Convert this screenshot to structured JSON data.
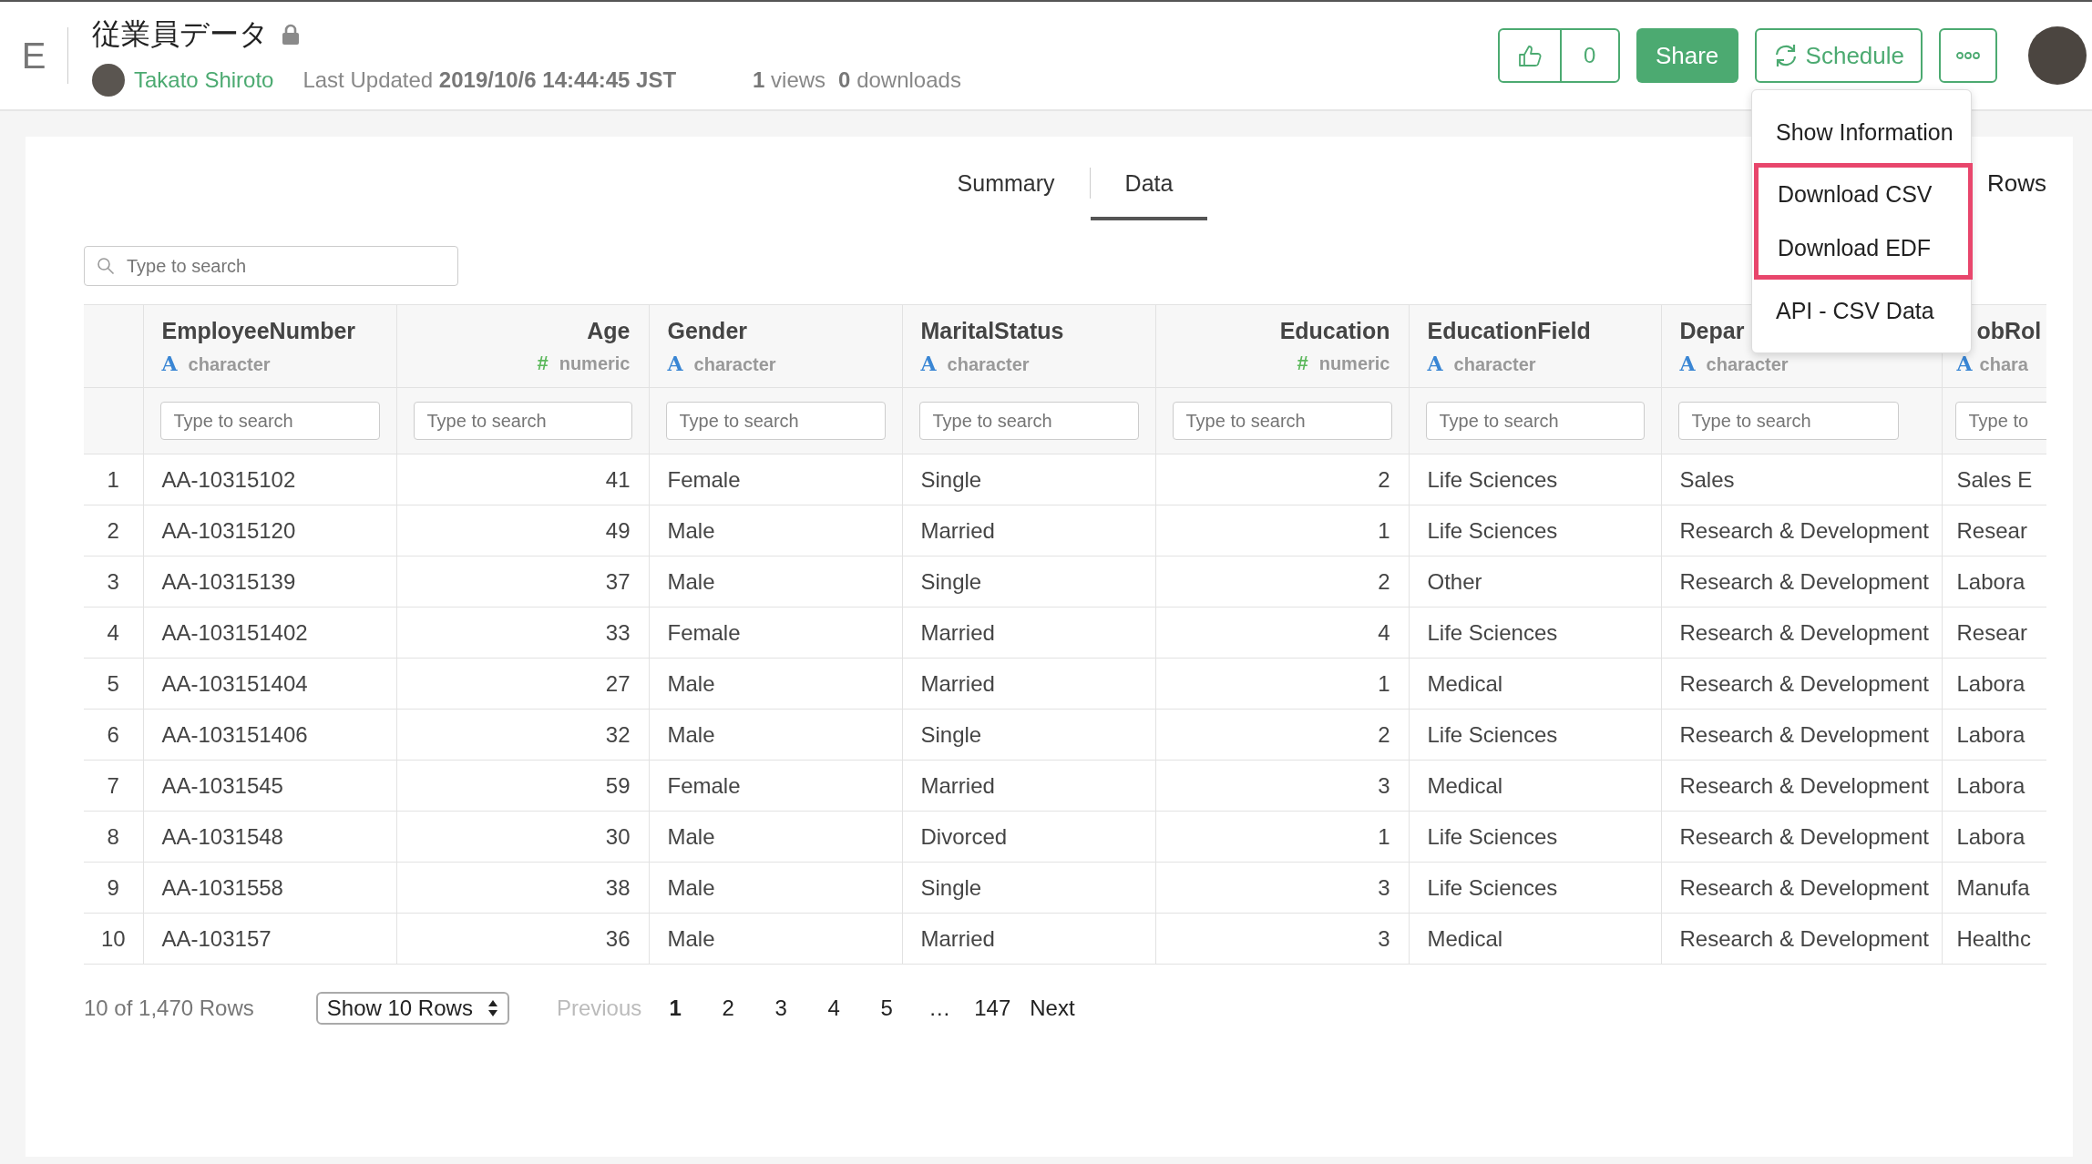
{
  "header": {
    "logo": "E",
    "title": "従業員データ",
    "locked": true,
    "author": "Takato Shiroto",
    "updated_label": "Last Updated",
    "updated_value": "2019/10/6 14:44:45 JST",
    "views_count": "1",
    "views_label": "views",
    "downloads_count": "0",
    "downloads_label": "downloads",
    "like_count": "0",
    "share_label": "Share",
    "schedule_label": "Schedule"
  },
  "menu": {
    "items": [
      {
        "label": "Show Information",
        "highlighted": false
      },
      {
        "label": "Download CSV",
        "highlighted": true
      },
      {
        "label": "Download EDF",
        "highlighted": true
      },
      {
        "label": "API - CSV Data",
        "highlighted": false
      }
    ]
  },
  "tabs": [
    {
      "label": "Summary",
      "selected": false
    },
    {
      "label": "Data",
      "selected": true
    }
  ],
  "rows_label": "Rows",
  "search": {
    "placeholder": "Type to search"
  },
  "table": {
    "columns": [
      {
        "name": "EmployeeNumber",
        "kind": "character",
        "type_icon": "A",
        "type_label": "character",
        "filter_placeholder": "Type to search"
      },
      {
        "name": "Age",
        "kind": "numeric",
        "type_icon": "#",
        "type_label": "numeric",
        "filter_placeholder": "Type to search"
      },
      {
        "name": "Gender",
        "kind": "character",
        "type_icon": "A",
        "type_label": "character",
        "filter_placeholder": "Type to search"
      },
      {
        "name": "MaritalStatus",
        "kind": "character",
        "type_icon": "A",
        "type_label": "character",
        "filter_placeholder": "Type to search"
      },
      {
        "name": "Education",
        "kind": "numeric",
        "type_icon": "#",
        "type_label": "numeric",
        "filter_placeholder": "Type to search"
      },
      {
        "name": "EducationField",
        "kind": "character",
        "type_icon": "A",
        "type_label": "character",
        "filter_placeholder": "Type to search"
      },
      {
        "name": "Depar",
        "kind": "character",
        "type_icon": "A",
        "type_label": "character",
        "filter_placeholder": "Type to search"
      },
      {
        "name": "obRol",
        "kind": "character",
        "type_icon": "A",
        "type_label": "chara",
        "filter_placeholder": "Type to"
      }
    ],
    "rows": [
      {
        "number": "1",
        "cells": [
          "AA-10315102",
          "41",
          "Female",
          "Single",
          "2",
          "Life Sciences",
          "Sales",
          "Sales E"
        ]
      },
      {
        "number": "2",
        "cells": [
          "AA-10315120",
          "49",
          "Male",
          "Married",
          "1",
          "Life Sciences",
          "Research & Development",
          "Resear"
        ]
      },
      {
        "number": "3",
        "cells": [
          "AA-10315139",
          "37",
          "Male",
          "Single",
          "2",
          "Other",
          "Research & Development",
          "Labora"
        ]
      },
      {
        "number": "4",
        "cells": [
          "AA-103151402",
          "33",
          "Female",
          "Married",
          "4",
          "Life Sciences",
          "Research & Development",
          "Resear"
        ]
      },
      {
        "number": "5",
        "cells": [
          "AA-103151404",
          "27",
          "Male",
          "Married",
          "1",
          "Medical",
          "Research & Development",
          "Labora"
        ]
      },
      {
        "number": "6",
        "cells": [
          "AA-103151406",
          "32",
          "Male",
          "Single",
          "2",
          "Life Sciences",
          "Research & Development",
          "Labora"
        ]
      },
      {
        "number": "7",
        "cells": [
          "AA-1031545",
          "59",
          "Female",
          "Married",
          "3",
          "Medical",
          "Research & Development",
          "Labora"
        ]
      },
      {
        "number": "8",
        "cells": [
          "AA-1031548",
          "30",
          "Male",
          "Divorced",
          "1",
          "Life Sciences",
          "Research & Development",
          "Labora"
        ]
      },
      {
        "number": "9",
        "cells": [
          "AA-1031558",
          "38",
          "Male",
          "Single",
          "3",
          "Life Sciences",
          "Research & Development",
          "Manufa"
        ]
      },
      {
        "number": "10",
        "cells": [
          "AA-103157",
          "36",
          "Male",
          "Married",
          "3",
          "Medical",
          "Research & Development",
          "Healthc"
        ]
      }
    ]
  },
  "pagination": {
    "summary": "10 of 1,470 Rows",
    "page_size": "Show 10 Rows",
    "previous": {
      "label": "Previous",
      "disabled": true
    },
    "pages": [
      {
        "label": "1",
        "selected": true
      },
      {
        "label": "2",
        "selected": false
      },
      {
        "label": "3",
        "selected": false
      },
      {
        "label": "4",
        "selected": false
      },
      {
        "label": "5",
        "selected": false
      },
      {
        "label": "…",
        "selected": false
      },
      {
        "label": "147",
        "selected": false
      }
    ],
    "next": {
      "label": "Next",
      "disabled": false
    }
  }
}
